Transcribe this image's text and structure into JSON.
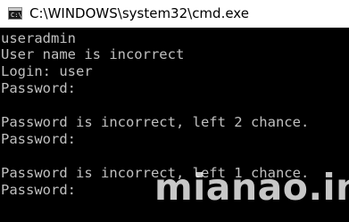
{
  "window": {
    "title": "C:\\WINDOWS\\system32\\cmd.exe",
    "icon": "cmd-icon",
    "icon_prompt": "C:\\"
  },
  "console": {
    "lines": [
      "useradmin",
      "User name is incorrect",
      "Login: user",
      "Password:",
      "",
      "Password is incorrect, left 2 chance.",
      "Password:",
      "",
      "Password is incorrect, left 1 chance.",
      "Password:"
    ]
  },
  "watermark": {
    "text": "mianao.info"
  },
  "colors": {
    "titlebar_background": "#ffffff",
    "console_background": "#000000",
    "console_text": "#c0c0c0"
  }
}
